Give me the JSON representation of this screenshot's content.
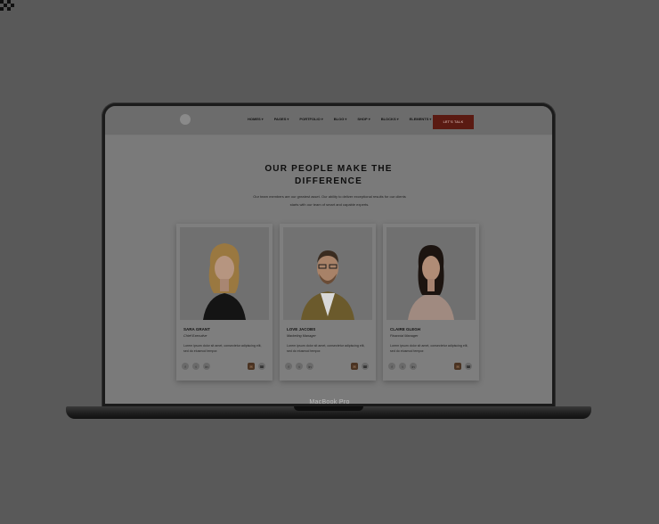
{
  "device": {
    "model_label": "MacBook Pro"
  },
  "header": {
    "nav": [
      {
        "label": "HOMES"
      },
      {
        "label": "PAGES"
      },
      {
        "label": "PORTFOLIO"
      },
      {
        "label": "BLOG"
      },
      {
        "label": "SHOP"
      },
      {
        "label": "BLOCKS"
      },
      {
        "label": "ELEMENTS"
      }
    ],
    "caret": "▾",
    "cta_label": "LET'S TALK"
  },
  "section": {
    "title": "OUR PEOPLE MAKE THE DIFFERENCE",
    "description": "Our team members are our greatest asset. Our ability to deliver exceptional results for our clients starts with our team of smart and capable experts."
  },
  "team": [
    {
      "name": "SARA GRANT",
      "role": "Chief Executive",
      "bio": "Lorem ipsum dolor sit amet, consectetur adipiscing elit, sed do eiusmod tempor.",
      "social": [
        "f",
        "t",
        "in"
      ],
      "contact": [
        "✉",
        "☎"
      ]
    },
    {
      "name": "LOVE JACOBS",
      "role": "Marketing Manager",
      "bio": "Lorem ipsum dolor sit amet, consectetur adipiscing elit, sed do eiusmod tempor.",
      "social": [
        "f",
        "t",
        "in"
      ],
      "contact": [
        "✉",
        "☎"
      ]
    },
    {
      "name": "CLAIRE GLEGH",
      "role": "Financial Manager",
      "bio": "Lorem ipsum dolor sit amet, consectetur adipiscing elit, sed do eiusmod tempor.",
      "social": [
        "f",
        "t",
        "in"
      ],
      "contact": [
        "✉",
        "☎"
      ]
    }
  ],
  "colors": {
    "background": "#595959",
    "cta": "#5a1a12",
    "card": "#7e7e7e"
  }
}
